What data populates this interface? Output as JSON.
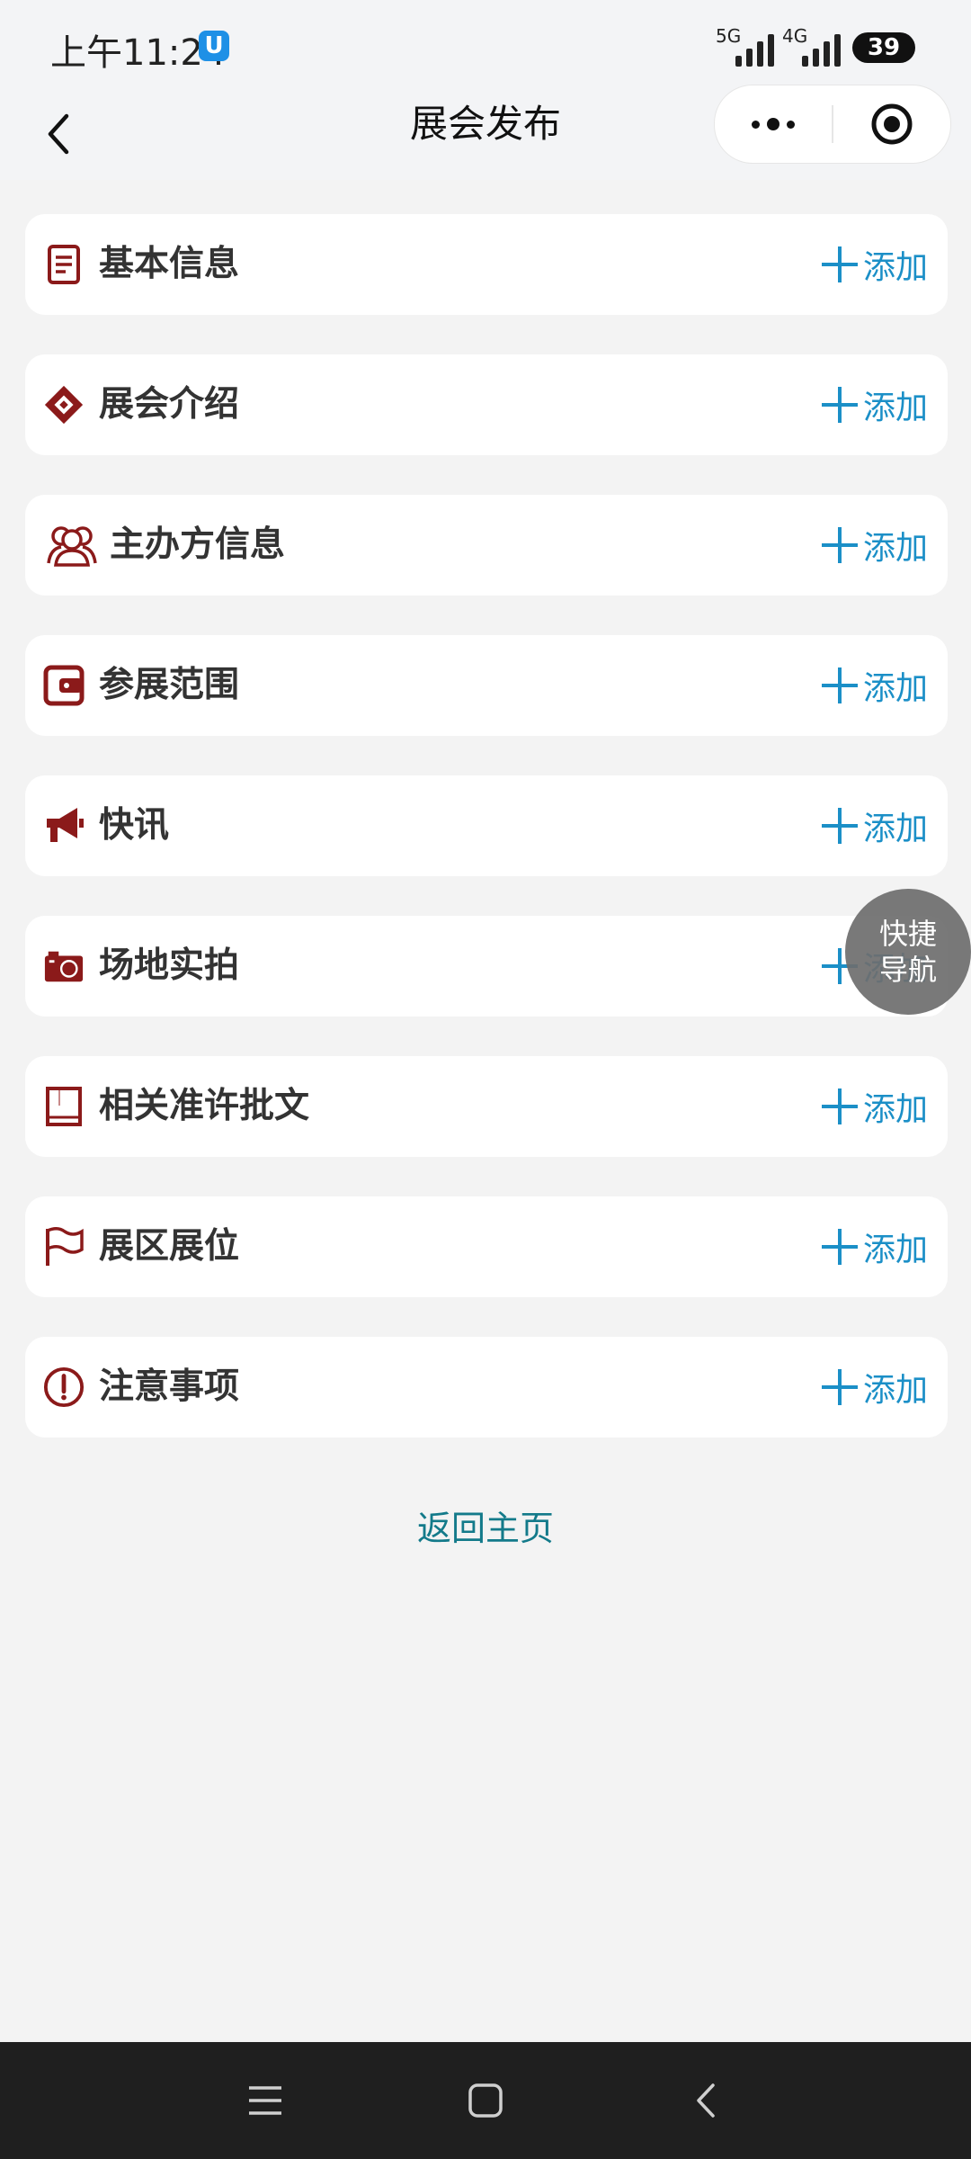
{
  "status_bar": {
    "time": "上午11:24",
    "app_badge": "U",
    "network_1": "5G",
    "network_2": "4G",
    "battery": "39"
  },
  "header": {
    "title": "展会发布",
    "back_icon": "chevron-left-icon",
    "more_icon": "more-dots-icon",
    "close_icon": "target-circle-icon"
  },
  "sections": [
    {
      "label": "基本信息",
      "icon": "document-icon",
      "action": "添加"
    },
    {
      "label": "展会介绍",
      "icon": "cube-icon",
      "action": "添加"
    },
    {
      "label": "主办方信息",
      "icon": "users-icon",
      "action": "添加"
    },
    {
      "label": "参展范围",
      "icon": "wallet-icon",
      "action": "添加"
    },
    {
      "label": "快讯",
      "icon": "megaphone-icon",
      "action": "添加"
    },
    {
      "label": "场地实拍",
      "icon": "camera-icon",
      "action": "添加"
    },
    {
      "label": "相关准许批文",
      "icon": "book-icon",
      "action": "添加"
    },
    {
      "label": "展区展位",
      "icon": "flag-icon",
      "action": "添加"
    },
    {
      "label": "注意事项",
      "icon": "alert-circle-icon",
      "action": "添加"
    }
  ],
  "home_link": "返回主页",
  "quick_nav": {
    "line1": "快捷",
    "line2": "导航"
  },
  "colors": {
    "icon_red": "#8b1a1a",
    "action_blue": "#1b8fc7",
    "link_teal": "#137a8a",
    "background": "#f3f3f3"
  }
}
